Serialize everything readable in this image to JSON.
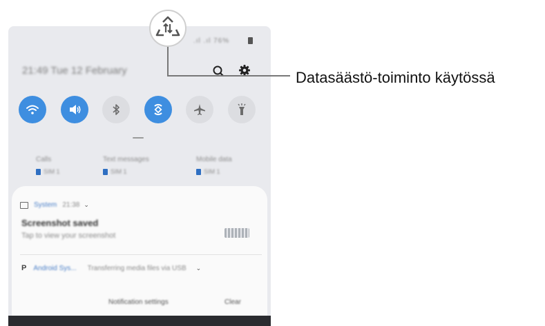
{
  "callout": {
    "label": "Datasäästö-toiminto käytössä"
  },
  "status_bar": {
    "signal": ".ıl .ıl",
    "percent": "76%"
  },
  "header": {
    "date_time": "21:49  Tue 12 February"
  },
  "quick_toggles": [
    {
      "name": "wifi",
      "icon": "wifi-icon",
      "state": "on"
    },
    {
      "name": "sound",
      "icon": "sound-icon",
      "state": "on"
    },
    {
      "name": "bluetooth",
      "icon": "bluetooth-icon",
      "state": "off"
    },
    {
      "name": "auto-rotate",
      "icon": "auto-rotate-icon",
      "state": "on"
    },
    {
      "name": "airplane",
      "icon": "airplane-icon",
      "state": "off"
    },
    {
      "name": "flashlight",
      "icon": "flashlight-icon",
      "state": "off"
    }
  ],
  "sim_settings": [
    {
      "label": "Calls",
      "sim": "SIM 1"
    },
    {
      "label": "Text messages",
      "sim": "SIM 1"
    },
    {
      "label": "Mobile data",
      "sim": "SIM 1"
    }
  ],
  "notification1": {
    "app": "System",
    "time": "21:38",
    "title": "Screenshot saved",
    "subtitle": "Tap to view your screenshot"
  },
  "notification2": {
    "app": "Android Sys...",
    "description": "Transferring media files via USB"
  },
  "actions": {
    "settings": "Notification settings",
    "clear": "Clear"
  },
  "colors": {
    "accent": "#3e8ee0",
    "panel_bg": "#e9eaee"
  }
}
